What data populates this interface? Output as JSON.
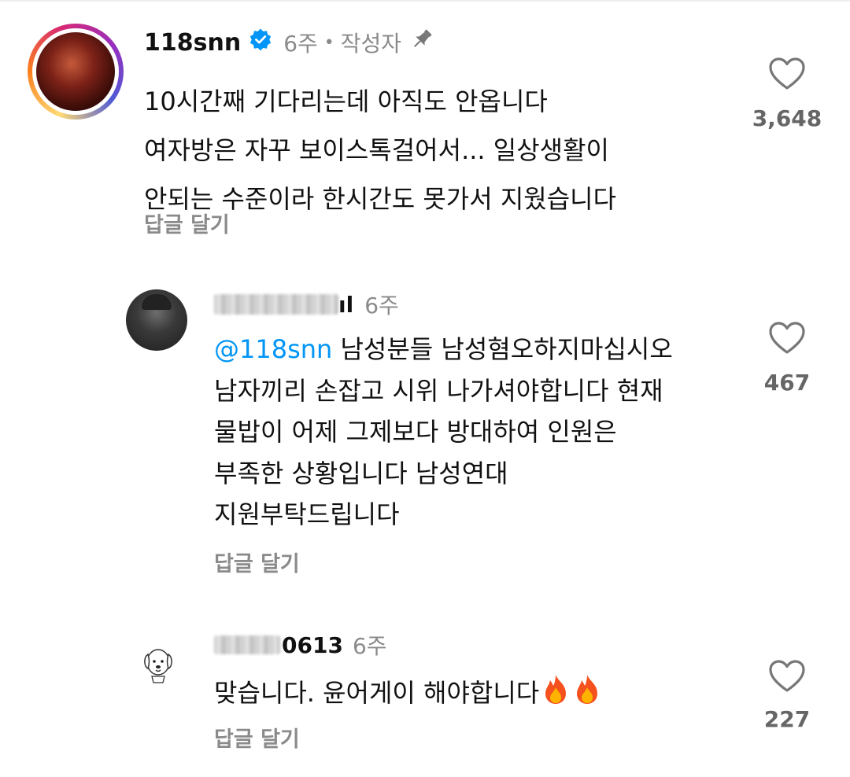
{
  "comments": [
    {
      "username": "118snn",
      "verified": true,
      "time": "6주",
      "author_badge": "작성자",
      "pinned": true,
      "text_lines": [
        "10시간째 기다리는데 아직도 안옵니다",
        "여자방은 자꾸 보이스톡걸어서... 일상생활이",
        "안되는 수준이라 한시간도 못가서 지웠습니다"
      ],
      "reply_label": "답글 달기",
      "likes": "3,648"
    },
    {
      "username_partial": "ıl",
      "time": "6주",
      "mention": "@118snn",
      "text_lines": [
        "남성분들 남성혐오하지마십시오",
        "남자끼리 손잡고 시위 나가셔야합니다 현재",
        "물밥이 어제 그제보다 방대하여 인원은",
        "부족한 상황입니다 남성연대",
        "지원부탁드립니다"
      ],
      "reply_label": "답글 달기",
      "likes": "467"
    },
    {
      "username_partial": "0613",
      "time": "6주",
      "text": "맞습니다. 윤어게이 해야합니다",
      "reply_label": "답글 달기",
      "likes": "227"
    }
  ],
  "icons": {
    "verified": "verified-badge-icon",
    "pin": "pin-icon",
    "like": "heart-outline-icon",
    "fire": "fire-emoji-icon"
  },
  "colors": {
    "verified": "#0095f6",
    "mention": "#0095f6",
    "muted": "#8a8a8a"
  }
}
